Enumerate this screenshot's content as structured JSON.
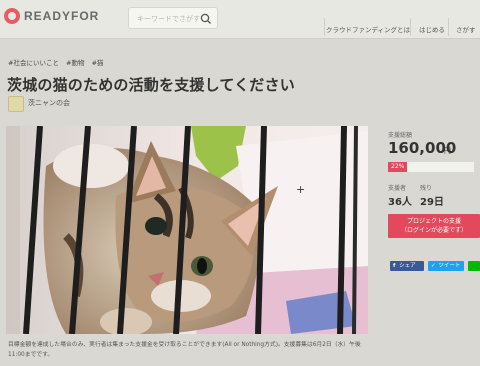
{
  "header": {
    "logo_text": "READYFOR",
    "search_placeholder": "キーワードでさがす",
    "nav": {
      "crowdfunding": "クラウドファンディングとは",
      "start": "はじめる",
      "search": "さがす"
    }
  },
  "project": {
    "tags": [
      "#社会にいいこと",
      "#動物",
      "#猫"
    ],
    "title": "茨城の猫のための活動を支援してください",
    "owner": "茨ニャンの会",
    "description": "目標金額を達成した場合のみ、実行者は集まった支援金を受け取ることができます(All or Nothing方式)。支援募集は6月2日（水）午後11:00までです。"
  },
  "sidebar": {
    "amount_label": "支援総額",
    "amount_value": "160,000",
    "amount_unit": "円",
    "progress_label": "22%",
    "progress_fraction": 0.22,
    "supporters_label": "支援者",
    "supporters_value": "36人",
    "remaining_label": "残り",
    "remaining_value": "29日",
    "support_button_line1": "プロジェクトの支援",
    "support_button_line2": "（ログインが必要です）",
    "share_facebook": "シェア",
    "share_twitter": "ツイート"
  },
  "colors": {
    "accent": "#e3495c",
    "facebook": "#3b5998",
    "twitter": "#1da1f2",
    "line": "#00b900"
  }
}
